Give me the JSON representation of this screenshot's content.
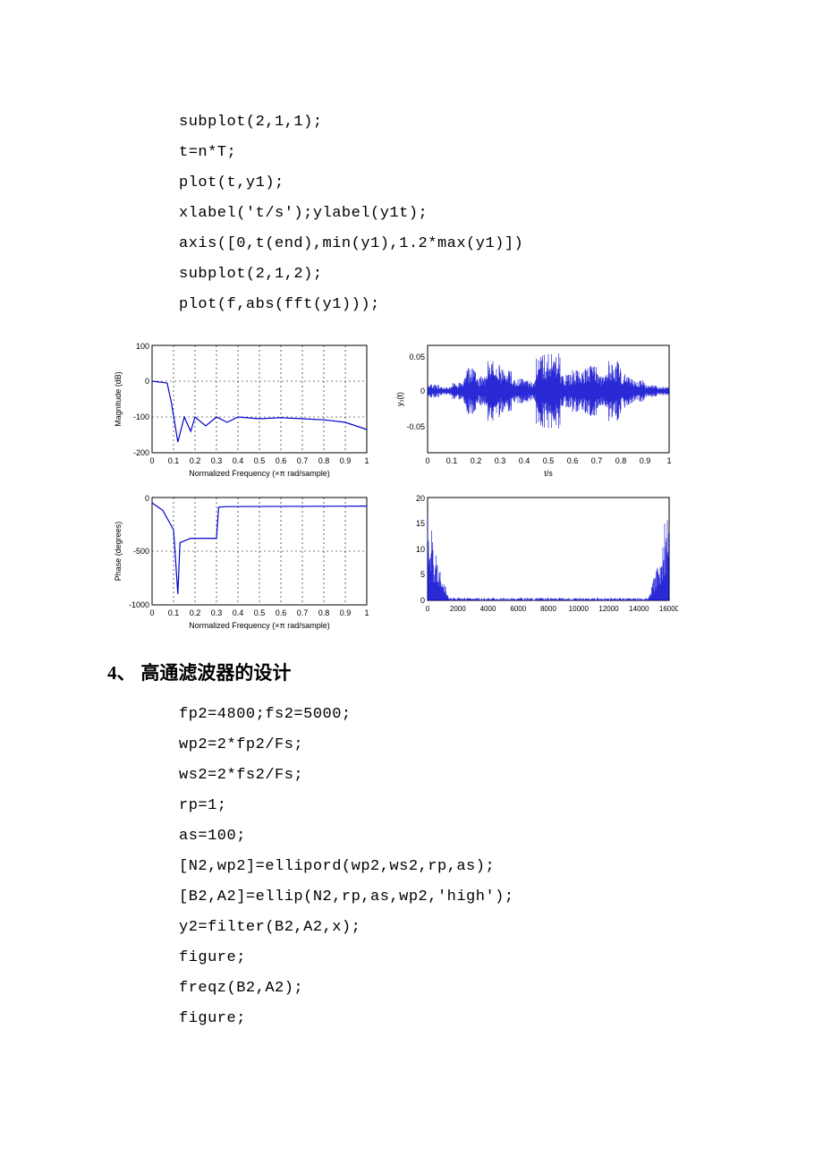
{
  "code1": [
    "subplot(2,1,1);",
    "t=n*T;",
    "plot(t,y1);",
    "xlabel('t/s');ylabel(y1t);",
    "axis([0,t(end),min(y1),1.2*max(y1)])",
    "subplot(2,1,2);",
    "plot(f,abs(fft(y1)));"
  ],
  "heading_num": "4、",
  "heading_text": "高通滤波器的设计",
  "code2": [
    "fp2=4800;fs2=5000;",
    "wp2=2*fp2/Fs;",
    "ws2=2*fs2/Fs;",
    "rp=1;",
    "as=100;",
    "[N2,wp2]=ellipord(wp2,ws2,rp,as);",
    "[B2,A2]=ellip(N2,rp,as,wp2,'high');",
    "y2=filter(B2,A2,x);",
    "figure;",
    "freqz(B2,A2);",
    "figure;"
  ],
  "chart_data": [
    {
      "type": "line",
      "title": "",
      "xlabel": "Normalized Frequency  (×π rad/sample)",
      "ylabel": "Magnitude (dB)",
      "xlim": [
        0,
        1
      ],
      "ylim": [
        -200,
        100
      ],
      "xticks": [
        0,
        0.1,
        0.2,
        0.3,
        0.4,
        0.5,
        0.6,
        0.7,
        0.8,
        0.9,
        1
      ],
      "yticks": [
        -200,
        -100,
        0,
        100
      ],
      "grid_dashed_x": true,
      "series": [
        {
          "name": "magnitude",
          "x": [
            0,
            0.07,
            0.09,
            0.12,
            0.15,
            0.18,
            0.2,
            0.25,
            0.3,
            0.35,
            0.4,
            0.5,
            0.6,
            0.7,
            0.8,
            0.9,
            1
          ],
          "y": [
            0,
            -5,
            -60,
            -170,
            -100,
            -140,
            -100,
            -125,
            -100,
            -115,
            -100,
            -105,
            -102,
            -105,
            -108,
            -115,
            -135
          ]
        }
      ]
    },
    {
      "type": "line",
      "title": "",
      "xlabel": "Normalized Frequency  (×π rad/sample)",
      "ylabel": "Phase (degrees)",
      "xlim": [
        0,
        1
      ],
      "ylim": [
        -1000,
        0
      ],
      "xticks": [
        0,
        0.1,
        0.2,
        0.3,
        0.4,
        0.5,
        0.6,
        0.7,
        0.8,
        0.9,
        1
      ],
      "yticks": [
        -1000,
        -500,
        0
      ],
      "grid_dashed_x": true,
      "series": [
        {
          "name": "phase",
          "x": [
            0,
            0.05,
            0.1,
            0.12,
            0.13,
            0.18,
            0.25,
            0.3,
            0.31,
            0.35,
            1
          ],
          "y": [
            -50,
            -120,
            -300,
            -900,
            -420,
            -380,
            -380,
            -380,
            -90,
            -85,
            -80
          ]
        }
      ]
    },
    {
      "type": "line",
      "title": "",
      "xlabel": "t/s",
      "ylabel": "y₁(t)",
      "xlim": [
        0,
        1
      ],
      "ylim": [
        -0.06,
        0.08
      ],
      "xticks": [
        0,
        0.1,
        0.2,
        0.3,
        0.4,
        0.5,
        0.6,
        0.7,
        0.8,
        0.9,
        1
      ],
      "yticks": [
        -0.05,
        0,
        0.05
      ],
      "description": "speech-like waveform, dense blue oscillations roughly in ±0.06 with several bursts"
    },
    {
      "type": "line",
      "title": "",
      "xlabel": "",
      "ylabel": "",
      "xlim": [
        0,
        16000
      ],
      "ylim": [
        0,
        20
      ],
      "xticks": [
        0,
        2000,
        4000,
        6000,
        8000,
        10000,
        12000,
        14000,
        16000
      ],
      "yticks": [
        0,
        5,
        10,
        15,
        20
      ],
      "description": "FFT magnitude spectrum, large peaks near 0–1500 and near 14500–16000 reaching ~18, near zero elsewhere"
    }
  ]
}
